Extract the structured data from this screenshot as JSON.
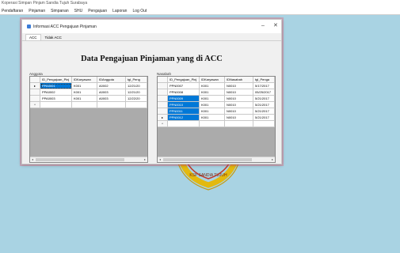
{
  "app": {
    "title": "Koperasi Simpan Pinjam Sandia Tujuh Surabaya",
    "menu": [
      "Pendaftaran",
      "Pinjaman",
      "Simpanan",
      "SHU",
      "Pengajuan",
      "Laporan",
      "Log Out"
    ]
  },
  "window": {
    "title": "Informasi ACC Pengajuan Pinjaman",
    "minimize": "–",
    "close": "✕",
    "tabs": [
      "ACC",
      "Tidak ACC"
    ],
    "heading": "Data Pengajuan Pinjaman yang di ACC"
  },
  "left_grid": {
    "label": "Anggota",
    "columns": [
      "ID_Pengajuan_Pinj",
      "IDKaryawan",
      "IDAnggota",
      "tgl_Peng"
    ],
    "rows": [
      [
        "PPA0001",
        "K001",
        "A0002",
        "12/21/20"
      ],
      [
        "PPA0002",
        "K001",
        "A0003",
        "12/21/20"
      ],
      [
        "PPA0003",
        "K001",
        "A0003",
        "12/22/20"
      ]
    ],
    "current_marker": "▸",
    "new_marker": "*",
    "scroll_left": "◂",
    "scroll_right": "▸"
  },
  "right_grid": {
    "label": "Nasabah",
    "columns": [
      "ID_Pengajuan_Pinj",
      "IDKaryawan",
      "IDNasabah",
      "tgl_Penga"
    ],
    "rows": [
      [
        "PPN0007",
        "K001",
        "N0010",
        "5/17/2017"
      ],
      [
        "PPN0008",
        "K001",
        "N0010",
        "05/25/2017"
      ],
      [
        "PPN0009",
        "K001",
        "N0010",
        "5/21/2017"
      ],
      [
        "PPN0010",
        "K001",
        "N0010",
        "5/21/2017"
      ],
      [
        "PPN0011",
        "K001",
        "N0010",
        "5/21/2017"
      ],
      [
        "PPN0012",
        "K001",
        "N0010",
        "5/21/2017"
      ]
    ],
    "current_marker": "▸",
    "new_marker": "*",
    "scroll_left": "◂",
    "scroll_right": "▸"
  },
  "colors": {
    "desktop": "#a9d3e3",
    "selection": "#0078d7",
    "logo_gold": "#e3b90f",
    "logo_red": "#c0392b"
  },
  "logo_text": "KSP SANDIA TUJUH"
}
